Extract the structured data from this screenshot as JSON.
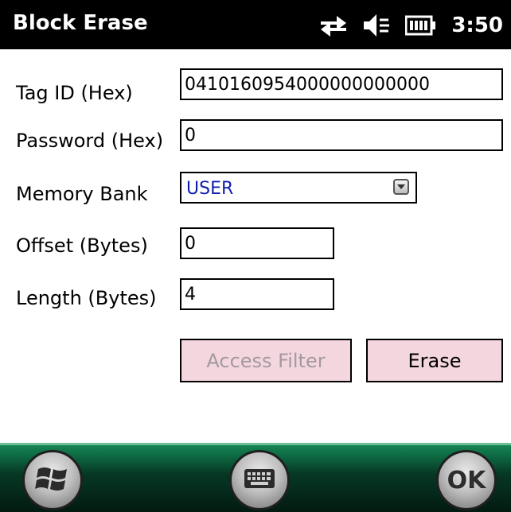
{
  "window": {
    "title": "Block Erase"
  },
  "status": {
    "clock": "3:50",
    "icons": [
      "sync-arrows-icon",
      "speaker-muted-icon",
      "battery-icon"
    ]
  },
  "form": {
    "tag_id": {
      "label": "Tag ID (Hex)",
      "value": "0410160954000000000000"
    },
    "password": {
      "label": "Password (Hex)",
      "value": "0"
    },
    "memory_bank": {
      "label": "Memory Bank",
      "value": "USER"
    },
    "offset": {
      "label": "Offset (Bytes)",
      "value": "0"
    },
    "length": {
      "label": "Length (Bytes)",
      "value": "4"
    }
  },
  "buttons": {
    "access_filter": "Access Filter",
    "erase": "Erase"
  },
  "softkeys": {
    "start_icon": "windows-flag-icon",
    "keyboard_icon": "keyboard-icon",
    "ok": "OK"
  },
  "colors": {
    "title_bar": "#000000",
    "button_fill": "#f4d6de",
    "combo_value": "#0f1faa",
    "softbar": "#0e6b43"
  }
}
